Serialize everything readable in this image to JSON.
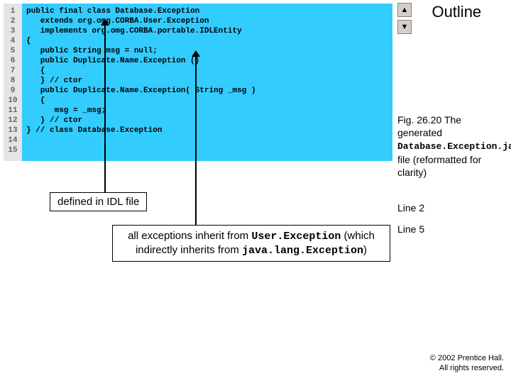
{
  "outline": {
    "title": "Outline"
  },
  "nav": {
    "up": "▲",
    "down": "▼"
  },
  "code": {
    "lines": [
      "1",
      "2",
      "3",
      "4",
      "5",
      "6",
      "7",
      "8",
      "9",
      "10",
      "11",
      "12",
      "13",
      "14",
      "15"
    ],
    "src": [
      "public final class Database.Exception",
      "   extends org.omg.CORBA.User.Exception",
      "   implements org.omg.CORBA.portable.IDLEntity",
      "{",
      "   public String msg = null;",
      "",
      "   public Duplicate.Name.Exception ()",
      "   {",
      "   } // ctor",
      "",
      "   public Duplicate.Name.Exception( String _msg )",
      "   {",
      "      msg = _msg;",
      "   } // ctor",
      "} // class Database.Exception"
    ]
  },
  "caption": {
    "pre": "Fig. 26.20 The generated ",
    "mono": "Database.Exception.java",
    "post": " file (reformatted for clarity)"
  },
  "refs": {
    "line2": "Line 2",
    "line5": "Line 5"
  },
  "callout1": "defined in IDL file",
  "callout2": {
    "pre": "all exceptions inherit from ",
    "m1": "User.Exception",
    "mid": " (which indirectly inherits from ",
    "m2": "java.lang.Exception",
    "post": ")"
  },
  "copyright": {
    "l1": "© 2002 Prentice Hall.",
    "l2": "All rights reserved."
  }
}
